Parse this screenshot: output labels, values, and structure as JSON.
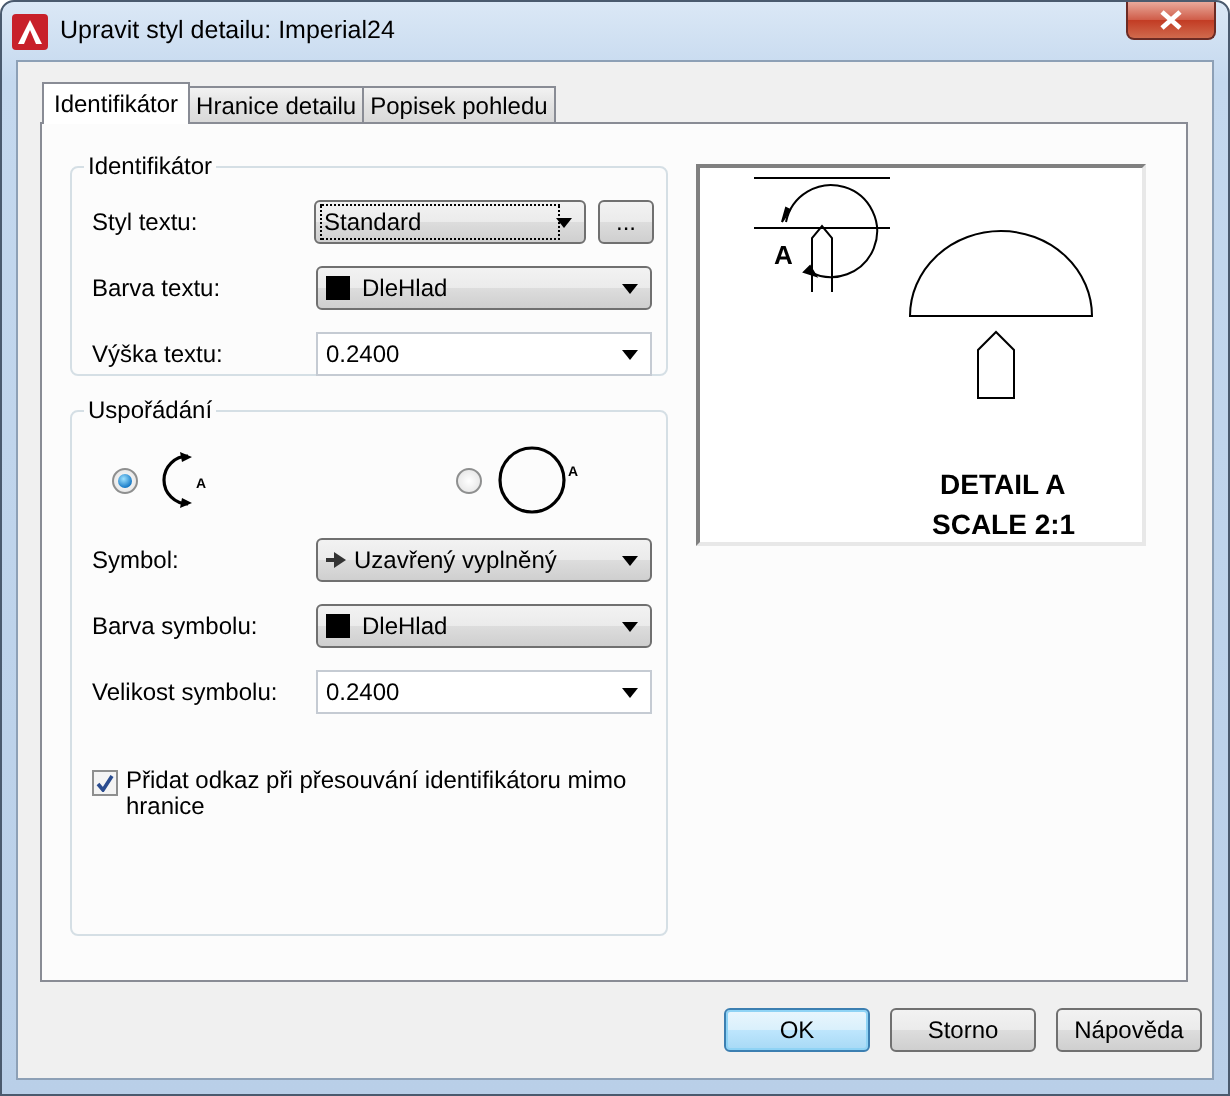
{
  "window": {
    "title": "Upravit styl detailu: Imperial24"
  },
  "tabs": [
    {
      "label": "Identifikátor",
      "selected": true
    },
    {
      "label": "Hranice detailu",
      "selected": false
    },
    {
      "label": "Popisek pohledu",
      "selected": false
    }
  ],
  "identifier_group": {
    "title": "Identifikátor",
    "fields": [
      {
        "label": "Styl textu:",
        "kind": "combo",
        "value": "Standard",
        "browse": "..."
      },
      {
        "label": "Barva textu:",
        "kind": "color",
        "value": "DleHlad",
        "color": "#000000"
      },
      {
        "label": "Výška textu:",
        "kind": "editable",
        "value": "0.2400"
      }
    ]
  },
  "arrangement_group": {
    "title": "Uspořádání",
    "options": [
      {
        "kind": "arrows",
        "letter": "A",
        "selected": true
      },
      {
        "kind": "plain",
        "letter": "A",
        "selected": false
      }
    ],
    "fields": [
      {
        "label": "Symbol:",
        "kind": "symbol",
        "value": "Uzavřený vyplněný"
      },
      {
        "label": "Barva symbolu:",
        "kind": "color",
        "value": "DleHlad",
        "color": "#000000"
      },
      {
        "label": "Velikost symbolu:",
        "kind": "editable",
        "value": "0.2400"
      }
    ],
    "checkbox": {
      "label": "Přidat odkaz při přesouvání identifikátoru mimo hranice",
      "checked": true
    }
  },
  "preview": {
    "letter": "A",
    "caption": [
      "DETAIL A",
      "SCALE 2:1"
    ]
  },
  "buttons": [
    {
      "label": "OK",
      "default": true
    },
    {
      "label": "Storno",
      "default": false
    },
    {
      "label": "Nápověda",
      "default": false
    }
  ]
}
